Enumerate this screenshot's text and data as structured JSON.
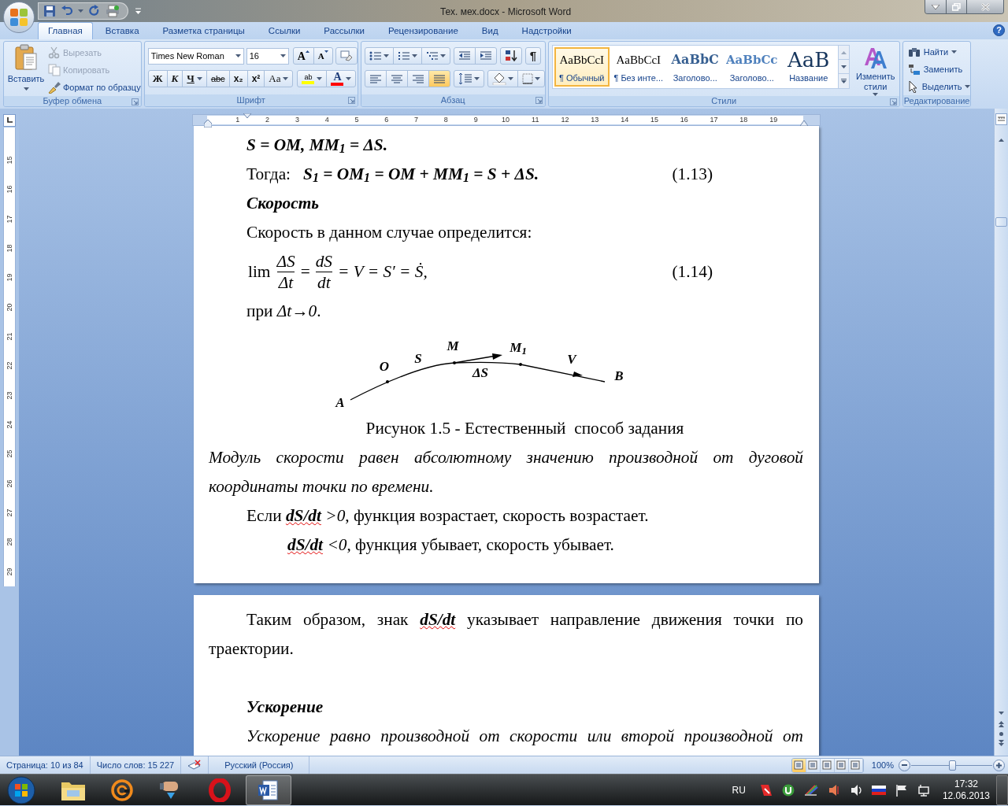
{
  "window": {
    "title": "Тех. мех.docx - Microsoft Word"
  },
  "help": "?",
  "tabs": [
    {
      "label": "Главная",
      "selected": true
    },
    {
      "label": "Вставка",
      "selected": false
    },
    {
      "label": "Разметка страницы",
      "selected": false
    },
    {
      "label": "Ссылки",
      "selected": false
    },
    {
      "label": "Рассылки",
      "selected": false
    },
    {
      "label": "Рецензирование",
      "selected": false
    },
    {
      "label": "Вид",
      "selected": false
    },
    {
      "label": "Надстройки",
      "selected": false
    }
  ],
  "clipboard": {
    "paste": "Вставить",
    "items": [
      {
        "label": "Вырезать",
        "disabled": true
      },
      {
        "label": "Копировать",
        "disabled": true
      },
      {
        "label": "Формат по образцу",
        "disabled": false
      }
    ],
    "group_label": "Буфер обмена"
  },
  "font": {
    "font_name": "Times New Roman",
    "font_size": "16",
    "size_buttons": [
      "A",
      "A"
    ],
    "format_buttons": [
      {
        "kind": "bold",
        "label": "Ж"
      },
      {
        "kind": "italic",
        "label": "К"
      },
      {
        "kind": "underline",
        "label": "Ч"
      },
      {
        "kind": "strike",
        "label": "abc"
      },
      {
        "kind": "subscript",
        "label": "x₂"
      },
      {
        "kind": "superscript",
        "label": "x²"
      },
      {
        "kind": "case",
        "label": "Aa"
      }
    ],
    "highlight": "ab",
    "font_color": "A",
    "group_label": "Шрифт"
  },
  "paragraph": {
    "show_marks": "¶",
    "alignment": [
      {
        "selected": false
      },
      {
        "selected": false
      },
      {
        "selected": false
      },
      {
        "selected": true
      }
    ],
    "group_label": "Абзац"
  },
  "styles": {
    "items": [
      {
        "kind": "normal",
        "preview": "AaBbCcI",
        "name": "¶ Обычный",
        "selected": true
      },
      {
        "kind": "normal",
        "preview": "AaBbCcI",
        "name": "¶ Без инте...",
        "selected": false
      },
      {
        "kind": "heading1",
        "preview": "AaBbC",
        "name": "Заголово...",
        "selected": false
      },
      {
        "kind": "heading2",
        "preview": "AaBbCc",
        "name": "Заголово...",
        "selected": false
      },
      {
        "kind": "title",
        "preview": "AaB",
        "name": "Название",
        "selected": false
      }
    ],
    "change_styles": "Изменить стили",
    "group_label": "Стили"
  },
  "editing": {
    "items": [
      {
        "kind": "find",
        "label": "Найти"
      },
      {
        "kind": "replace",
        "label": "Заменить"
      },
      {
        "kind": "select",
        "label": "Выделить"
      }
    ],
    "group_label": "Редактирование"
  },
  "ruler": {
    "horizontal": [
      "1",
      "2",
      "3",
      "4",
      "5",
      "6",
      "7",
      "8",
      "9",
      "10",
      "11",
      "12",
      "13",
      "14",
      "15",
      "16",
      "17",
      "18",
      "19"
    ],
    "vertical": [
      "15",
      "16",
      "17",
      "18",
      "19",
      "20",
      "21",
      "22",
      "23",
      "24",
      "25",
      "26",
      "27",
      "28",
      "29"
    ]
  },
  "pages": [
    {
      "blocks": [
        {
          "kind": "formula",
          "text": "S = OM, MM$_{1}$ = ΔS."
        },
        {
          "kind": "numbered",
          "lead": "Тогда:",
          "formula": "S$_{1}$ = OM$_{1}$ = OM + MM$_{1}$ = S + ΔS.",
          "number": "(1.13)"
        },
        {
          "kind": "heading",
          "text": "Скорость",
          "space_before": false
        },
        {
          "kind": "text",
          "text": "Скорость в данном случае определится:"
        },
        {
          "kind": "limit",
          "lim": "lim",
          "num1": "ΔS",
          "den1": "Δt",
          "eq": "=",
          "num2": "dS",
          "den2": "dt",
          "rest": "= V = S′ = Ṡ,",
          "number": "(1.14)"
        },
        {
          "kind": "text",
          "text": "при *Δt→0*."
        },
        {
          "kind": "figure",
          "labels": [
            "A",
            "O",
            "S",
            "M",
            "M$_{1}$",
            "ΔS",
            "V",
            "B"
          ],
          "caption": "Рисунок 1.5 - Естественный  способ задания"
        },
        {
          "kind": "italic_justified",
          "text": "Модуль скорости равен абсолютному значению производной от дуговой координаты точки по времени."
        },
        {
          "kind": "text",
          "text": "Если **dS/dt** *>0*, функция возрастает, скорость возрастает."
        },
        {
          "kind": "text_deep",
          "text": "**dS/dt** *<0*, функция убывает, скорость убывает."
        }
      ]
    },
    {
      "blocks": [
        {
          "kind": "justified",
          "text": "Таким образом, знак **dS/dt** указывает направление движения точки по траектории."
        },
        {
          "kind": "heading",
          "text": "Ускорение",
          "space_before": true
        },
        {
          "kind": "italic_justified_last",
          "text": "Ускорение равно производной от скорости или второй производной от"
        }
      ]
    }
  ],
  "status_bar": {
    "page": "Страница: 10 из 84",
    "words": "Число слов: 15 227",
    "language": "Русский (Россия)",
    "views": [
      {
        "selected": true
      },
      {
        "selected": false
      },
      {
        "selected": false
      },
      {
        "selected": false
      },
      {
        "selected": false
      }
    ],
    "zoom": "100%",
    "zoom_slider": {
      "level": 0.5
    }
  },
  "taskbar": {
    "language": "RU",
    "time": "17:32",
    "date": "12.06.2013"
  }
}
